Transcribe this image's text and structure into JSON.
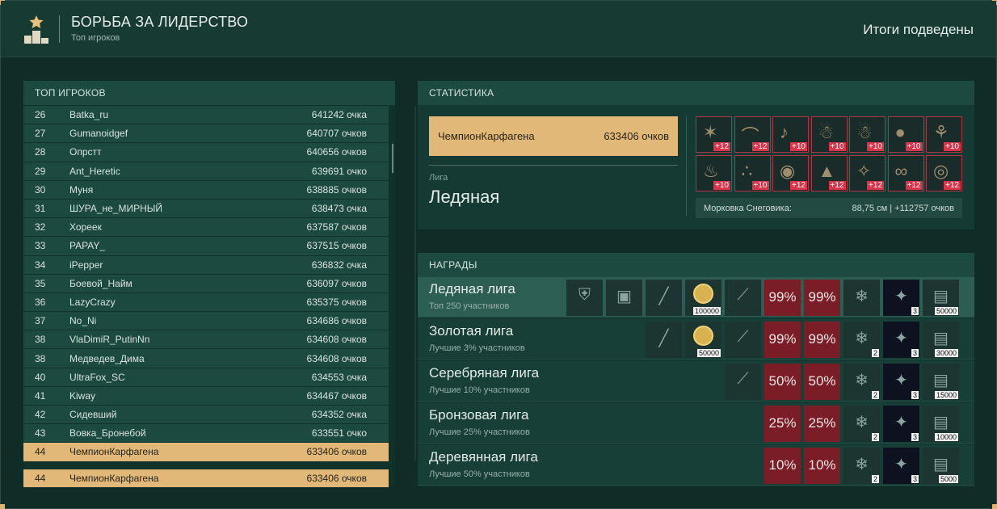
{
  "header": {
    "title": "БОРЬБА ЗА ЛИДЕРСТВО",
    "subtitle": "Топ игроков",
    "status": "Итоги подведены",
    "icon": "podium-star-icon"
  },
  "leaderboard": {
    "title": "ТОП ИГРОКОВ",
    "rows": [
      {
        "rank": "26",
        "name": "Batka_ru",
        "points": "641242 очка"
      },
      {
        "rank": "27",
        "name": "Gumanoidgef",
        "points": "640707 очков"
      },
      {
        "rank": "28",
        "name": "Опрстт",
        "points": "640656 очков"
      },
      {
        "rank": "29",
        "name": "Ant_Heretic",
        "points": "639691 очко"
      },
      {
        "rank": "30",
        "name": "Муня",
        "points": "638885 очков"
      },
      {
        "rank": "31",
        "name": "ШУРА_не_МИРНЫЙ",
        "points": "638473 очка"
      },
      {
        "rank": "32",
        "name": "Хореек",
        "points": "637587 очков"
      },
      {
        "rank": "33",
        "name": "PAPAY_",
        "points": "637515 очков"
      },
      {
        "rank": "34",
        "name": "iPepper",
        "points": "636832 очка"
      },
      {
        "rank": "35",
        "name": "Боевой_Найм",
        "points": "636097 очков"
      },
      {
        "rank": "36",
        "name": "LazyCrazy",
        "points": "635375 очков"
      },
      {
        "rank": "37",
        "name": "No_Ni",
        "points": "634686 очков"
      },
      {
        "rank": "38",
        "name": "VlaDimiR_PutinNn",
        "points": "634608 очков"
      },
      {
        "rank": "38",
        "name": "Медведев_Дима",
        "points": "634608 очков"
      },
      {
        "rank": "40",
        "name": "UltraFox_SC",
        "points": "634553 очка"
      },
      {
        "rank": "41",
        "name": "Kiway",
        "points": "634467 очков"
      },
      {
        "rank": "42",
        "name": "Сидевший",
        "points": "634352 очка"
      },
      {
        "rank": "43",
        "name": "Вовка_Бронебой",
        "points": "633551 очко"
      },
      {
        "rank": "44",
        "name": "ЧемпионКарфагена",
        "points": "633406 очков",
        "highlight": true
      }
    ],
    "me": {
      "rank": "44",
      "name": "ЧемпионКарфагена",
      "points": "633406 очков"
    }
  },
  "stats": {
    "title": "СТАТИСТИКА",
    "player_name": "ЧемпионКарфагена",
    "player_points": "633406 очков",
    "league_label": "Лига",
    "league_name": "Ледяная",
    "items": [
      {
        "badge": "+12",
        "icon": "star-garland-icon"
      },
      {
        "badge": "+12",
        "icon": "garland-icon"
      },
      {
        "badge": "+10",
        "icon": "bells-icon"
      },
      {
        "badge": "+10",
        "icon": "gingerbread-icon"
      },
      {
        "badge": "+10",
        "icon": "snowman-icon"
      },
      {
        "badge": "+10",
        "icon": "berries-icon"
      },
      {
        "badge": "+10",
        "icon": "branch-icon"
      },
      {
        "badge": "+10",
        "icon": "candles-icon"
      },
      {
        "badge": "+10",
        "icon": "lights-icon"
      },
      {
        "badge": "+12",
        "icon": "ornaments-icon"
      },
      {
        "badge": "+12",
        "icon": "tree-icon"
      },
      {
        "badge": "+12",
        "icon": "angel-icon"
      },
      {
        "badge": "+12",
        "icon": "ribbon-icon"
      },
      {
        "badge": "+12",
        "icon": "wreath-icon"
      }
    ],
    "carrot_label": "Морковка Снеговика:",
    "carrot_value": "88,75 см | +112757 очков"
  },
  "rewards": {
    "title": "НАГРАДЫ",
    "rows": [
      {
        "title": "Ледяная лига",
        "sub": "Топ 250 участников",
        "current": true,
        "items": [
          {
            "type": "plain",
            "icon": "armor-icon"
          },
          {
            "type": "plain",
            "icon": "device-icon"
          },
          {
            "type": "plain",
            "icon": "rifle-icon"
          },
          {
            "type": "coin",
            "icon": "crown-coin-icon",
            "qty": "100000"
          },
          {
            "type": "plain",
            "icon": "knife-icon"
          },
          {
            "type": "red",
            "pct": "99%"
          },
          {
            "type": "red",
            "pct": "99%"
          },
          {
            "type": "plain",
            "icon": "snowflake-medal-icon"
          },
          {
            "type": "dark",
            "icon": "sparkle-box-icon",
            "qty": "3"
          },
          {
            "type": "plain",
            "icon": "map-icon",
            "qty": "50000"
          }
        ]
      },
      {
        "title": "Золотая лига",
        "sub": "Лучшие 3% участников",
        "items": [
          {
            "type": "plain",
            "icon": "rifle-icon"
          },
          {
            "type": "coin",
            "icon": "crown-coin-icon",
            "qty": "50000"
          },
          {
            "type": "plain",
            "icon": "knife-icon"
          },
          {
            "type": "red",
            "pct": "99%"
          },
          {
            "type": "red",
            "pct": "99%"
          },
          {
            "type": "plain",
            "icon": "snowflake-medal-icon",
            "qty": "2"
          },
          {
            "type": "dark",
            "icon": "sparkle-box-icon",
            "qty": "3"
          },
          {
            "type": "plain",
            "icon": "map-icon",
            "qty": "30000"
          }
        ]
      },
      {
        "title": "Серебряная лига",
        "sub": "Лучшие 10% участников",
        "items": [
          {
            "type": "plain",
            "icon": "knife-icon"
          },
          {
            "type": "red",
            "pct": "50%"
          },
          {
            "type": "red",
            "pct": "50%"
          },
          {
            "type": "plain",
            "icon": "snowflake-medal-icon",
            "qty": "2"
          },
          {
            "type": "dark",
            "icon": "sparkle-box-icon",
            "qty": "3"
          },
          {
            "type": "plain",
            "icon": "map-icon",
            "qty": "15000"
          }
        ]
      },
      {
        "title": "Бронзовая лига",
        "sub": "Лучшие 25% участников",
        "items": [
          {
            "type": "red",
            "pct": "25%"
          },
          {
            "type": "red",
            "pct": "25%"
          },
          {
            "type": "plain",
            "icon": "snowflake-medal-icon",
            "qty": "2"
          },
          {
            "type": "dark",
            "icon": "sparkle-box-icon",
            "qty": "3"
          },
          {
            "type": "plain",
            "icon": "map-icon",
            "qty": "10000"
          }
        ]
      },
      {
        "title": "Деревянная лига",
        "sub": "Лучшие 50% участников",
        "items": [
          {
            "type": "red",
            "pct": "10%"
          },
          {
            "type": "red",
            "pct": "10%"
          },
          {
            "type": "plain",
            "icon": "snowflake-medal-icon",
            "qty": "2"
          },
          {
            "type": "dark",
            "icon": "sparkle-box-icon",
            "qty": "3"
          },
          {
            "type": "plain",
            "icon": "map-icon",
            "qty": "5000"
          }
        ]
      }
    ]
  },
  "colors": {
    "accent": "#e1b877",
    "panel": "#153a33",
    "badge_red": "#d8354b"
  }
}
